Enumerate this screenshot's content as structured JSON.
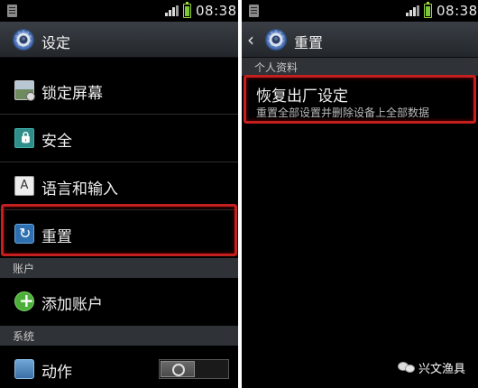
{
  "left_screen": {
    "status_time": "08:38",
    "title": "设定",
    "items": [
      {
        "label": "锁定屏幕",
        "icon": "lock-screen-icon"
      },
      {
        "label": "安全",
        "icon": "security-icon"
      },
      {
        "label": "语言和输入",
        "icon": "language-icon",
        "icon_glyph": "A"
      },
      {
        "label": "重置",
        "icon": "reset-icon",
        "highlighted": true
      }
    ],
    "section_accounts": "账户",
    "add_account": {
      "label": "添加账户",
      "icon": "add-account-icon"
    },
    "section_system": "系统",
    "motion": {
      "label": "动作",
      "icon": "motion-icon",
      "toggle": "off"
    }
  },
  "right_screen": {
    "status_time": "08:38",
    "title": "重置",
    "section_personal": "个人资料",
    "factory_reset": {
      "title": "恢复出厂设定",
      "subtitle": "重置全部设置并删除设备上全部数据",
      "highlighted": true
    }
  },
  "watermark": {
    "text": "兴文渔具",
    "icon": "wechat-icon"
  },
  "colors": {
    "highlight": "#c41f1f",
    "battery": "#7cc63a",
    "background": "#000000"
  }
}
